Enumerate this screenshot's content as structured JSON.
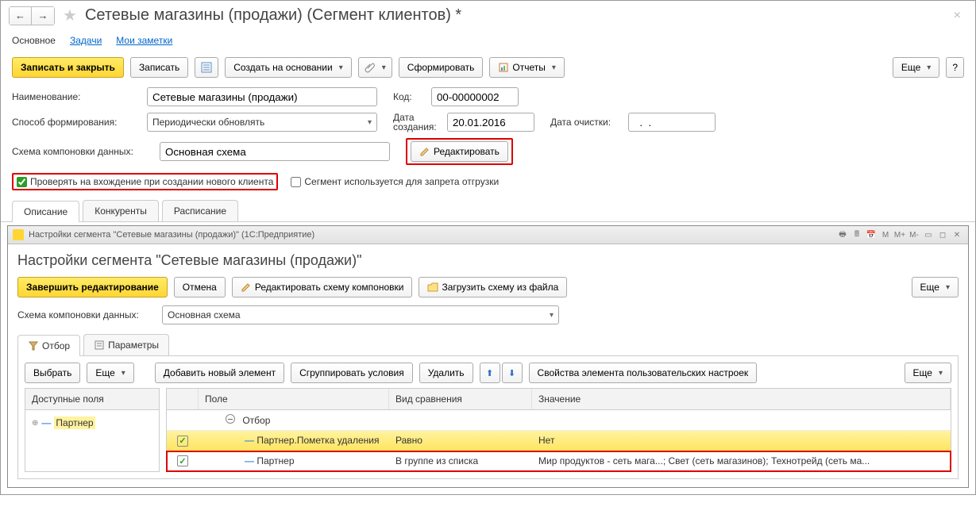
{
  "window": {
    "title": "Сетевые магазины (продажи) (Сегмент клиентов) *"
  },
  "topTabs": {
    "main": "Основное",
    "tasks": "Задачи",
    "notes": "Мои заметки"
  },
  "toolbar": {
    "saveAndClose": "Записать и закрыть",
    "save": "Записать",
    "createBased": "Создать на основании",
    "generate": "Сформировать",
    "reports": "Отчеты",
    "more": "Еще",
    "help": "?"
  },
  "form": {
    "nameLabel": "Наименование:",
    "nameValue": "Сетевые магазины (продажи)",
    "codeLabel": "Код:",
    "codeValue": "00-00000002",
    "methodLabel": "Способ формирования:",
    "methodValue": "Периодически обновлять",
    "createdLabel": "Дата создания:",
    "createdValue": "20.01.2016",
    "clearedLabel": "Дата очистки:",
    "clearedValue": "  .  .",
    "schemaLabel": "Схема компоновки данных:",
    "schemaValue": "Основная схема",
    "editBtn": "Редактировать",
    "chkValidateLabel": "Проверять на вхождение при создании нового клиента",
    "chkBanLabel": "Сегмент используется для запрета отгрузки"
  },
  "subTabs": {
    "desc": "Описание",
    "comp": "Конкуренты",
    "sched": "Расписание"
  },
  "inner": {
    "titlebar": "Настройки сегмента \"Сетевые магазины (продажи)\" (1С:Предприятие)",
    "title": "Настройки сегмента \"Сетевые магазины (продажи)\"",
    "finish": "Завершить редактирование",
    "cancel": "Отмена",
    "editSchema": "Редактировать схему компоновки",
    "loadSchema": "Загрузить схему из файла",
    "more": "Еще",
    "schemaLabel": "Схема компоновки данных:",
    "schemaValue": "Основная схема"
  },
  "filterTabs": {
    "filter": "Отбор",
    "params": "Параметры"
  },
  "filterToolbar": {
    "choose": "Выбрать",
    "more1": "Еще",
    "addNew": "Добавить новый элемент",
    "group": "Сгруппировать условия",
    "delete": "Удалить",
    "userProps": "Свойства элемента пользовательских настроек",
    "more2": "Еще"
  },
  "leftPane": {
    "header": "Доступные поля",
    "partner": "Партнер"
  },
  "gridHeaders": {
    "field": "Поле",
    "cmp": "Вид сравнения",
    "val": "Значение"
  },
  "gridRows": {
    "root": "Отбор",
    "r1_field": "Партнер.Пометка удаления",
    "r1_cmp": "Равно",
    "r1_val": "Нет",
    "r2_field": "Партнер",
    "r2_cmp": "В группе из списка",
    "r2_val": "Мир продуктов - сеть мага...; Свет (сеть магазинов); Технотрейд (сеть ма..."
  },
  "mControls": {
    "m": "M",
    "mp": "M+",
    "mm": "M-"
  }
}
